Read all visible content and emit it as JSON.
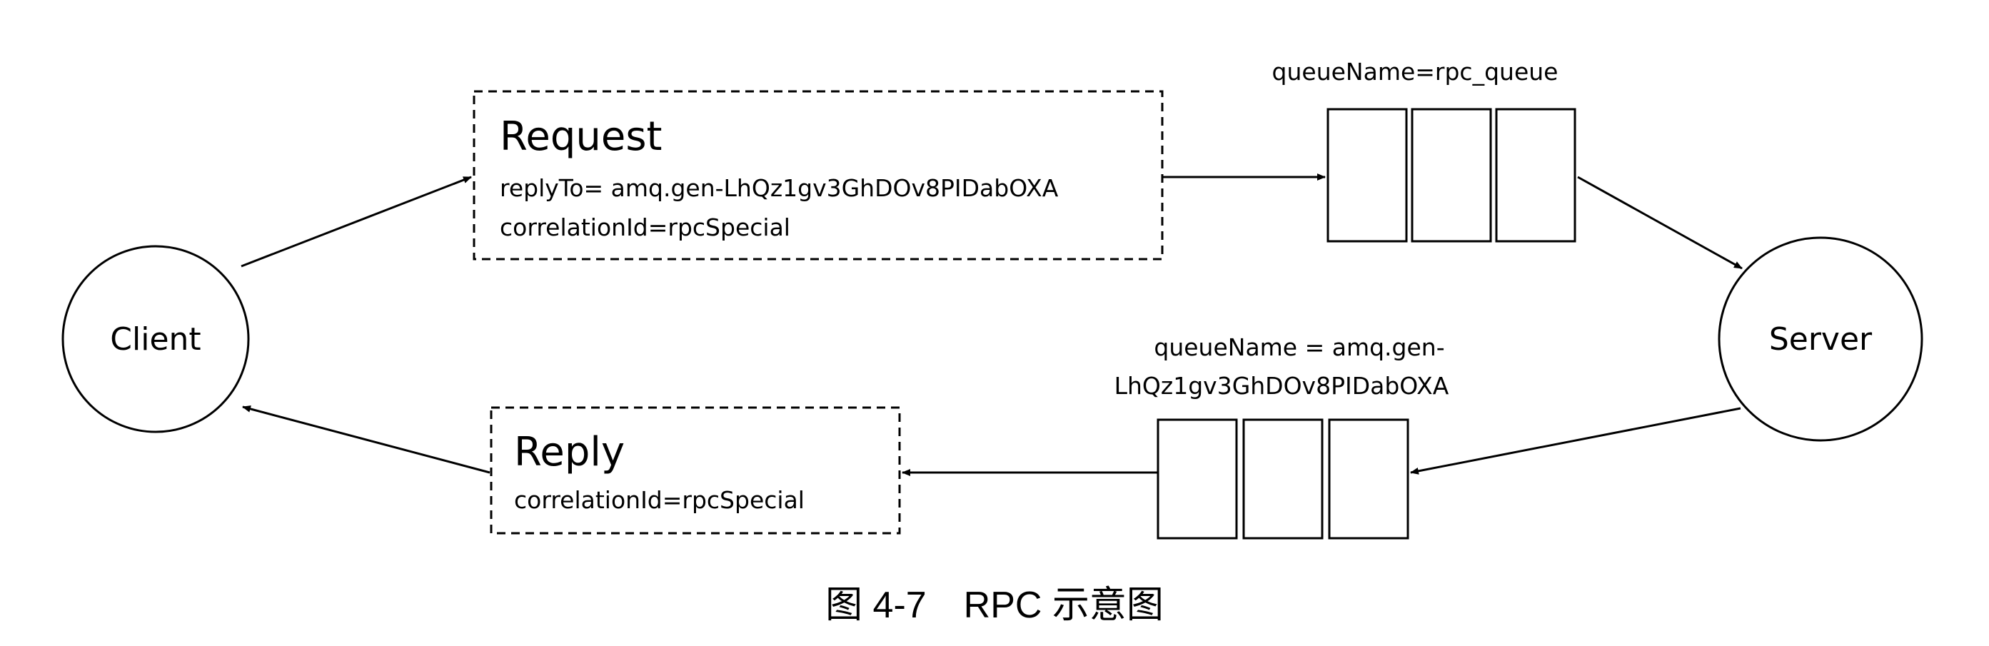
{
  "nodes": {
    "client": "Client",
    "server": "Server"
  },
  "request": {
    "title": "Request",
    "reply_to": "replyTo= amq.gen-LhQz1gv3GhDOv8PIDabOXA",
    "correlation_id": "correlationId=rpcSpecial"
  },
  "reply": {
    "title": "Reply",
    "correlation_id": "correlationId=rpcSpecial"
  },
  "rpc_queue": {
    "label": "queueName=rpc_queue"
  },
  "reply_queue": {
    "label_line1": "queueName = amq.gen-",
    "label_line2": "LhQz1gv3GhDOv8PIDabOXA"
  },
  "caption": "图 4-7　RPC 示意图"
}
